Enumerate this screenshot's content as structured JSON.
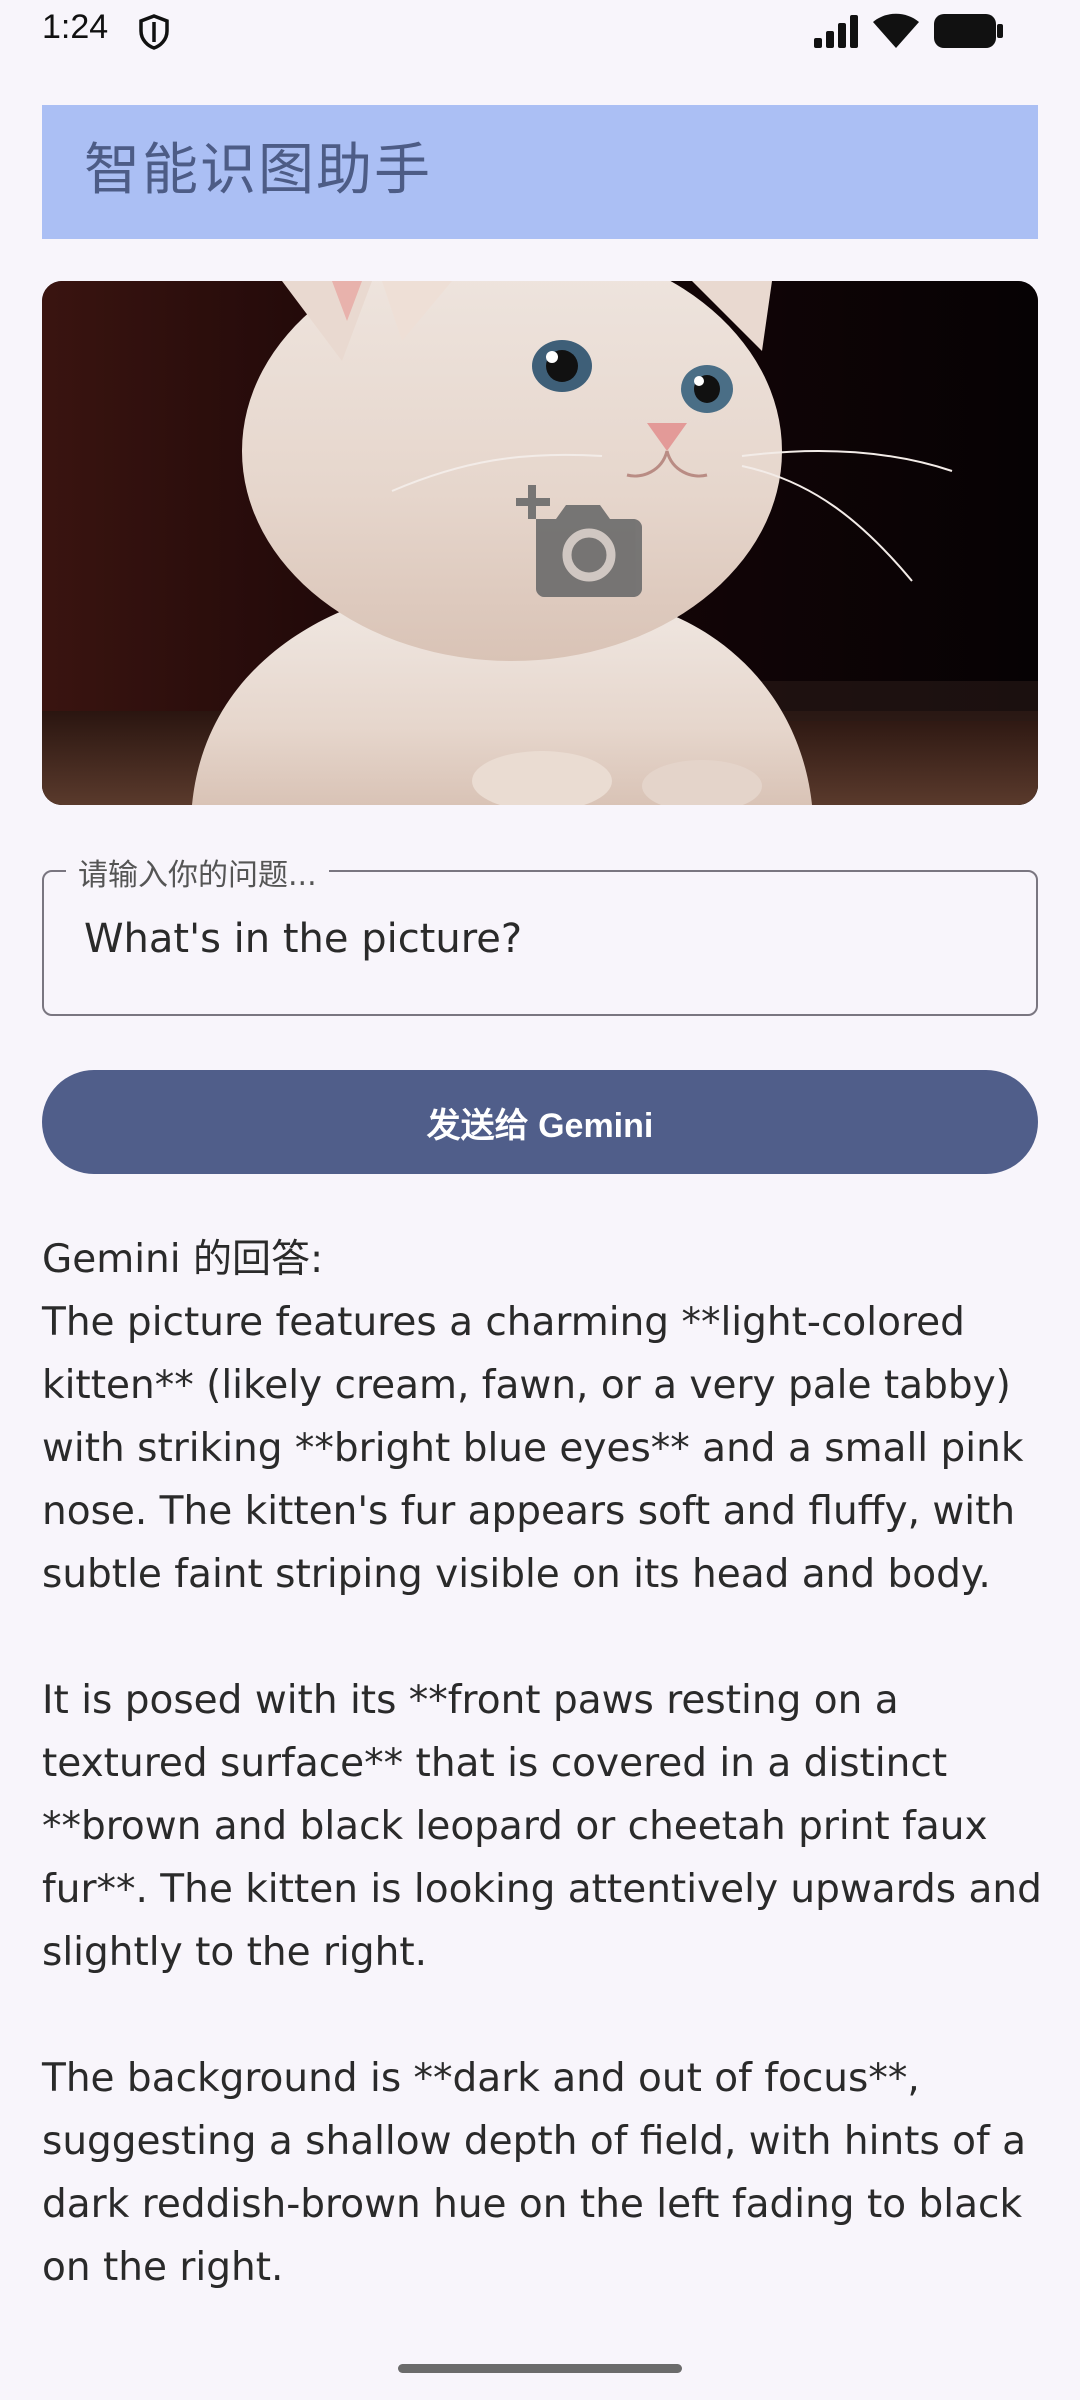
{
  "status_bar": {
    "time": "1:24",
    "icons": [
      "shield-icon",
      "signal-icon",
      "wifi-icon",
      "battery-icon"
    ]
  },
  "header": {
    "title": "智能识图助手",
    "background_color": "#abbff4",
    "title_color": "#4d5c86"
  },
  "image_picker": {
    "icon": "add-photo-icon",
    "image_subject": "cat"
  },
  "question_input": {
    "label": "请输入你的问题...",
    "value": "What's in the picture?"
  },
  "send_button": {
    "label": "发送给 Gemini",
    "color": "#505e8a"
  },
  "answer": {
    "heading": "Gemini 的回答:",
    "paragraphs": [
      "The picture features a charming **light-colored kitten** (likely cream, fawn, or a very pale tabby) with striking **bright blue eyes** and a small pink nose. The kitten's fur appears soft and fluffy, with subtle faint striping visible on its head and body.",
      "It is posed with its **front paws resting on a textured surface** that is covered in a distinct **brown and black leopard or cheetah print faux fur**. The kitten is looking attentively upwards and slightly to the right.",
      "The background is **dark and out of focus**, suggesting a shallow depth of field, with hints of a dark reddish-brown hue on the left fading to black on the right."
    ]
  }
}
